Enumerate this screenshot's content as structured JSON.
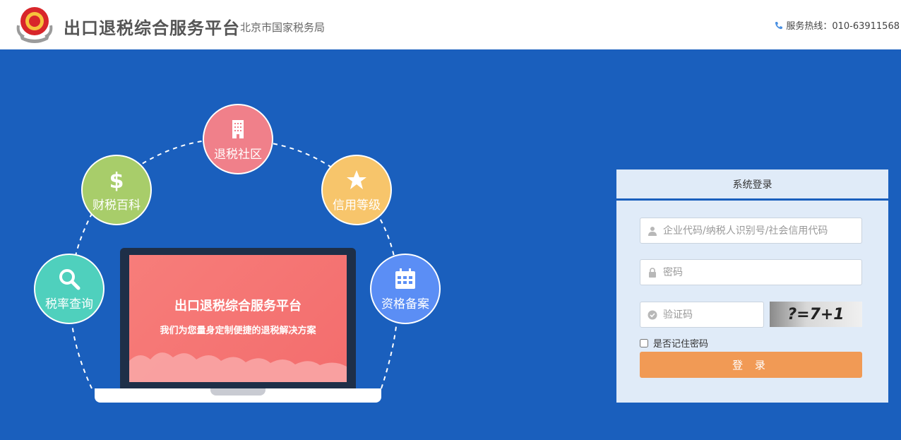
{
  "header": {
    "title": "出口退税综合服务平台",
    "subtitle": "北京市国家税务局",
    "hotline": "服务热线：010-63911568",
    "emblem_icon": "tax-emblem-icon",
    "phone_icon": "phone-icon"
  },
  "illustration": {
    "bubbles": [
      {
        "label": "退税社区",
        "icon": "building-icon",
        "color": "#f0808a"
      },
      {
        "label": "财税百科",
        "icon": "dollar-icon",
        "color": "#a8cd6a"
      },
      {
        "label": "信用等级",
        "icon": "star-icon",
        "color": "#f7c56b"
      },
      {
        "label": "税率查询",
        "icon": "search-icon",
        "color": "#4fd0bd"
      },
      {
        "label": "资格备案",
        "icon": "calendar-icon",
        "color": "#5b8ef5"
      }
    ],
    "screen": {
      "title": "出口退税综合服务平台",
      "subtitle": "我们为您量身定制便捷的退税解决方案"
    }
  },
  "login": {
    "title": "系统登录",
    "username_placeholder": "企业代码/纳税人识别号/社会信用代码",
    "password_placeholder": "密码",
    "captcha_placeholder": "验证码",
    "captcha_text": "?=7+1",
    "remember_label": "是否记住密码",
    "submit_label": "登 录",
    "accent": "#f19a55"
  },
  "colors": {
    "background": "#1a5fbd",
    "panel": "#e0ebf8"
  }
}
